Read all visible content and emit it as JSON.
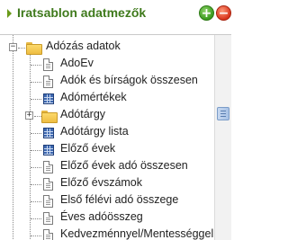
{
  "header": {
    "title": "Iratsablon adatmezők",
    "add_icon": "plus-icon",
    "remove_icon": "minus-icon",
    "add_glyph": "+",
    "remove_glyph": "−"
  },
  "tree": {
    "root": {
      "label": "Adózás adatok",
      "expander": "−",
      "icon": "folder-icon"
    },
    "items": [
      {
        "label": "AdoEv",
        "icon": "document-icon"
      },
      {
        "label": "Adók és bírságok összesen",
        "icon": "document-icon"
      },
      {
        "label": "Adómértékek",
        "icon": "table-icon"
      },
      {
        "label": "Adótárgy",
        "icon": "folder-icon",
        "expander": "+"
      },
      {
        "label": "Adótárgy lista",
        "icon": "table-icon"
      },
      {
        "label": "Előző évek",
        "icon": "table-icon"
      },
      {
        "label": "Előző évek adó összesen",
        "icon": "document-icon"
      },
      {
        "label": "Előző évszámok",
        "icon": "document-icon"
      },
      {
        "label": "Első félévi adó összege",
        "icon": "document-icon"
      },
      {
        "label": "Éves adóösszeg",
        "icon": "document-icon"
      },
      {
        "label": "Kedvezménnyel/Mentességgel",
        "icon": "document-icon"
      }
    ]
  },
  "colors": {
    "title_green": "#3f7a1c",
    "add_green": "#3a9a1e",
    "remove_red": "#d8341c",
    "folder_yellow": "#eebd42",
    "table_blue": "#3e68b0"
  }
}
